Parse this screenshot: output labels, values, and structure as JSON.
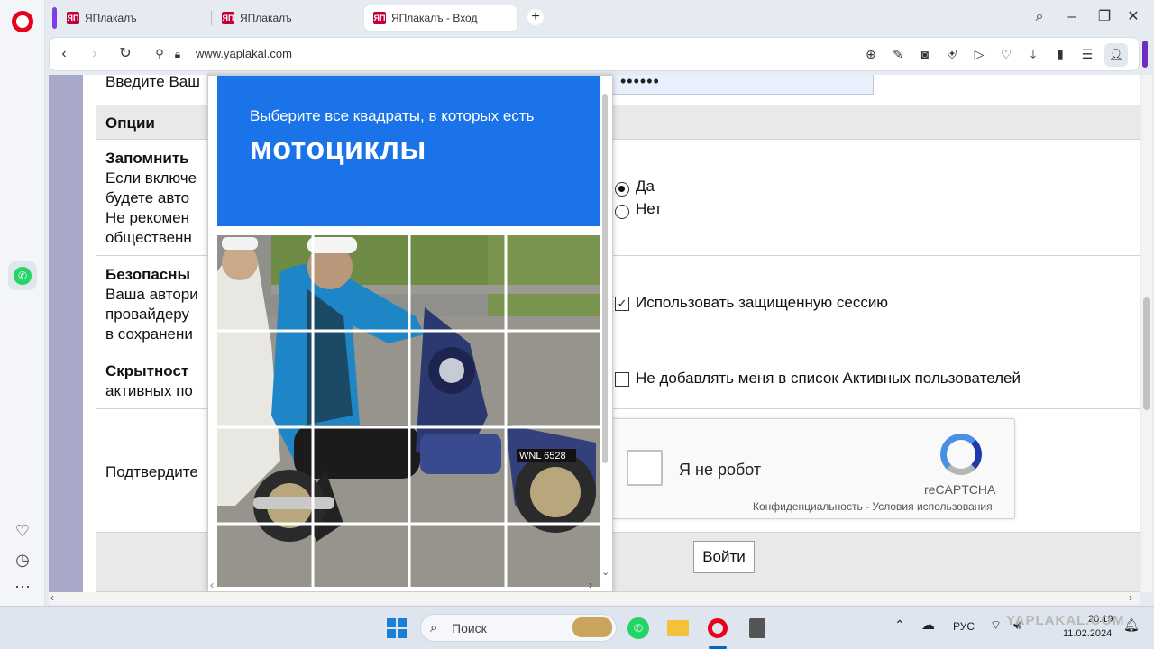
{
  "browser": {
    "tabs": [
      {
        "title": "ЯПлакалъ",
        "active": false
      },
      {
        "title": "ЯПлакалъ",
        "active": false
      },
      {
        "title": "ЯПлакалъ - Вход",
        "active": true
      }
    ],
    "url": "www.yaplakal.com",
    "favicon_text": "ЯП"
  },
  "form": {
    "password_label": "Введите Ваш",
    "password_dots": "••••••",
    "options_header": "Опции",
    "remember": {
      "title": "Запомнить",
      "lines": [
        "Если включе",
        "будете авто",
        "Не рекомен",
        "общественн"
      ],
      "yes": "Да",
      "no": "Нет",
      "selected": "Да"
    },
    "secure": {
      "title": "Безопасны",
      "lines": [
        "Ваша автори",
        "провайдеру",
        "в сохранени"
      ],
      "checkbox_label": "Использовать защищенную сессию",
      "checked": true
    },
    "hidden": {
      "title": "Скрытност",
      "lines": [
        "активных по"
      ],
      "checkbox_label": "Не добавлять меня в список Активных пользователей",
      "checked": false
    },
    "confirm_label": "Подтвердите",
    "login_button": "Войти"
  },
  "recaptcha": {
    "label": "Я не робот",
    "brand": "reCAPTCHA",
    "privacy": "Конфиденциальность",
    "separator": " - ",
    "terms": "Условия использования"
  },
  "captcha_challenge": {
    "instruction": "Выберите все квадраты, в которых есть",
    "target": "мотоциклы",
    "grid": "4x4",
    "plate_text": "WNL 6528"
  },
  "taskbar": {
    "search_placeholder": "Поиск",
    "language": "РУС",
    "time": "20:19",
    "date": "11.02.2024",
    "watermark": "YAPLAKAL.COM"
  },
  "colors": {
    "captcha_blue": "#1a73e8",
    "opera_red": "#e8001c",
    "whatsapp_green": "#25d366"
  }
}
